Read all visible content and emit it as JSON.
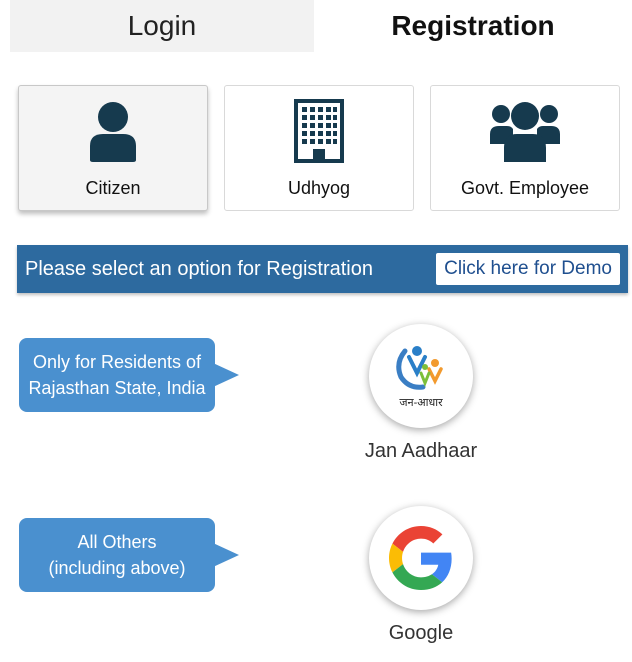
{
  "tabs": {
    "login": "Login",
    "registration": "Registration"
  },
  "options": [
    {
      "label": "Citizen",
      "icon": "user-icon"
    },
    {
      "label": "Udhyog",
      "icon": "building-icon"
    },
    {
      "label": "Govt. Employee",
      "icon": "users-icon"
    }
  ],
  "banner": {
    "text": "Please select an option for Registration",
    "demo": "Click here for Demo"
  },
  "providers": [
    {
      "note_line1": "Only for Residents of",
      "note_line2": "Rajasthan State, India",
      "label": "Jan Aadhaar",
      "logo_text": "जन-आधार"
    },
    {
      "note_line1": "All Others",
      "note_line2": "(including above)",
      "label": "Google"
    }
  ],
  "colors": {
    "banner": "#2d6a9f",
    "callout": "#4a90cf",
    "icon": "#163a4e"
  }
}
